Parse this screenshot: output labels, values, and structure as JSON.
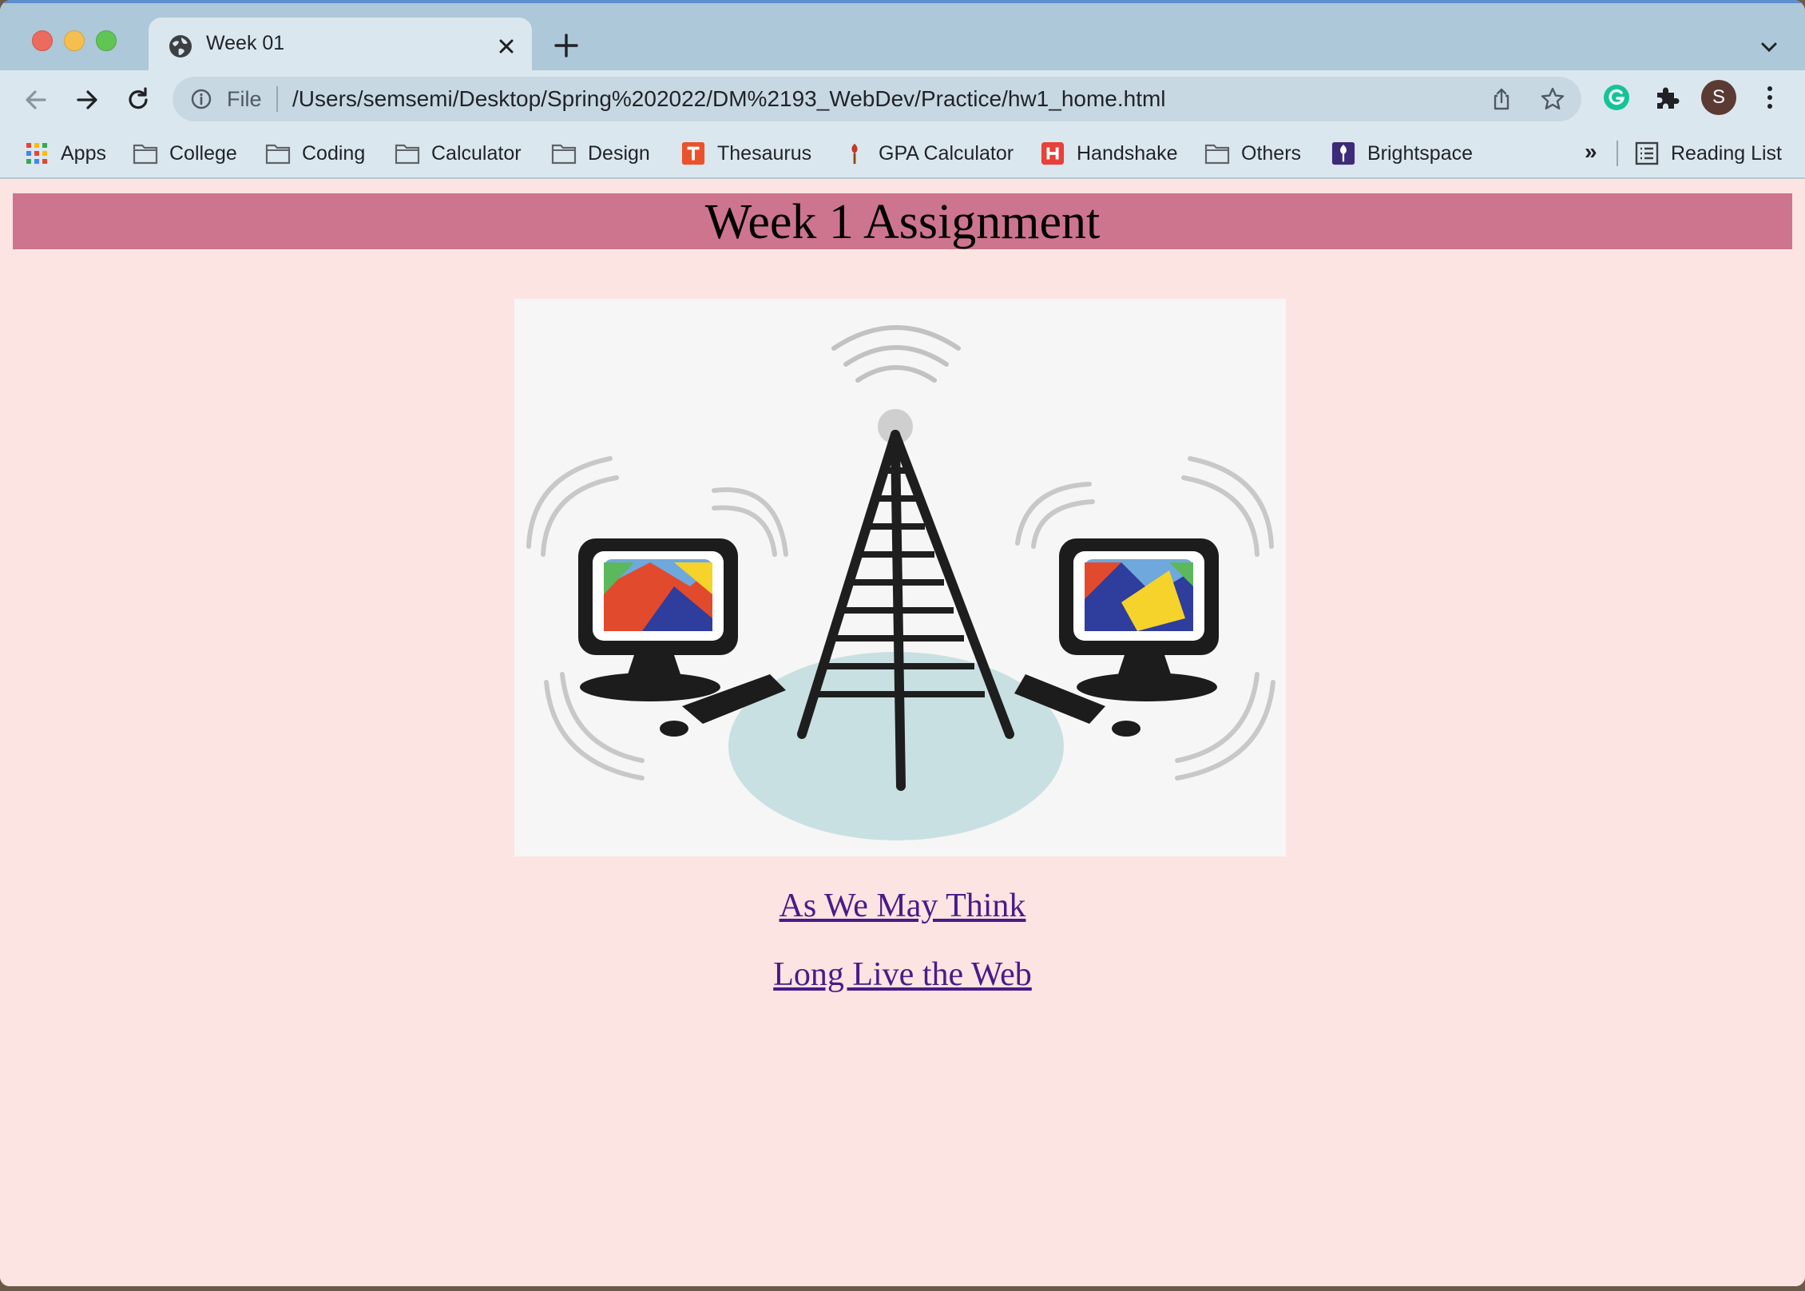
{
  "tab": {
    "title": "Week 01"
  },
  "omnibox": {
    "scheme_label": "File",
    "url": "/Users/semsemi/Desktop/Spring%202022/DM%2193_WebDev/Practice/hw1_home.html"
  },
  "profile": {
    "initial": "S"
  },
  "bookmarks": {
    "items": [
      {
        "label": "Apps",
        "icon": "apps-grid-icon"
      },
      {
        "label": "College",
        "icon": "folder-icon"
      },
      {
        "label": "Coding",
        "icon": "folder-icon"
      },
      {
        "label": "Calculator",
        "icon": "folder-icon"
      },
      {
        "label": "Design",
        "icon": "folder-icon"
      },
      {
        "label": "Thesaurus",
        "icon": "thesaurus-favicon"
      },
      {
        "label": "GPA Calculator",
        "icon": "gpa-favicon"
      },
      {
        "label": "Handshake",
        "icon": "handshake-favicon"
      },
      {
        "label": "Others",
        "icon": "folder-icon"
      },
      {
        "label": "Brightspace",
        "icon": "brightspace-favicon"
      }
    ],
    "overflow": "»",
    "reading_list": "Reading List"
  },
  "page": {
    "heading": "Week 1 Assignment",
    "links": [
      "As We May Think",
      "Long Live the Web"
    ],
    "image": "cell-tower-and-computers-illustration"
  },
  "colors": {
    "tabstrip": "#adc8d9",
    "toolbar": "#dbe7ee",
    "page_background": "#fbe4e2",
    "banner": "#cd758e",
    "link": "#4a1b87"
  }
}
